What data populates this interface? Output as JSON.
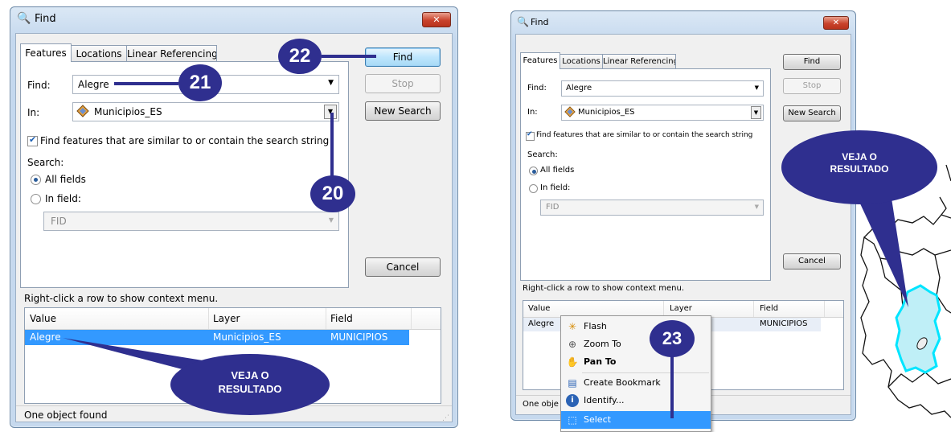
{
  "left_dialog": {
    "title": "Find",
    "close_glyph": "✕",
    "tabs": [
      "Features",
      "Locations",
      "Linear Referencing"
    ],
    "find_label": "Find:",
    "find_value": "Alegre",
    "in_label": "In:",
    "in_value": "Municipios_ES",
    "similar_checkbox_label": "Find features that are similar to or contain the search string",
    "search_label": "Search:",
    "radio_all_fields": "All fields",
    "radio_in_field": "In field:",
    "field_combo_value": "FID",
    "buttons": {
      "find": "Find",
      "stop": "Stop",
      "new_search": "New Search",
      "cancel": "Cancel"
    },
    "context_hint": "Right-click a row to show context menu.",
    "columns": [
      "Value",
      "Layer",
      "Field"
    ],
    "rows": [
      {
        "value": "Alegre",
        "layer": "Municipios_ES",
        "field": "MUNICIPIOS"
      }
    ],
    "status": "One object found"
  },
  "right_dialog": {
    "title": "Find",
    "close_glyph": "✕",
    "tabs": [
      "Features",
      "Locations",
      "Linear Referencing"
    ],
    "find_label": "Find:",
    "find_value": "Alegre",
    "in_label": "In:",
    "in_value": "Municipios_ES",
    "similar_checkbox_label": "Find features that are similar to or contain the search string",
    "search_label": "Search:",
    "radio_all_fields": "All fields",
    "radio_in_field": "In field:",
    "field_combo_value": "FID",
    "buttons": {
      "find": "Find",
      "stop": "Stop",
      "new_search": "New Search",
      "cancel": "Cancel"
    },
    "context_hint": "Right-click a row to show context menu.",
    "columns": [
      "Value",
      "Layer",
      "Field"
    ],
    "rows": [
      {
        "value": "Alegre",
        "layer": "",
        "field": "MUNICIPIOS"
      }
    ],
    "status": "One obje"
  },
  "context_menu": {
    "items": [
      "Flash",
      "Zoom To",
      "Pan To",
      "Create Bookmark",
      "Identify...",
      "Select"
    ]
  },
  "annotations": {
    "n20": "20",
    "n21": "21",
    "n22": "22",
    "n23": "23",
    "veja_line1": "VEJA O",
    "veja_line2": "RESULTADO"
  },
  "colors": {
    "callout": "#2f2f8f",
    "selection": "#3399ff",
    "map_highlight": "#00e5ff"
  }
}
